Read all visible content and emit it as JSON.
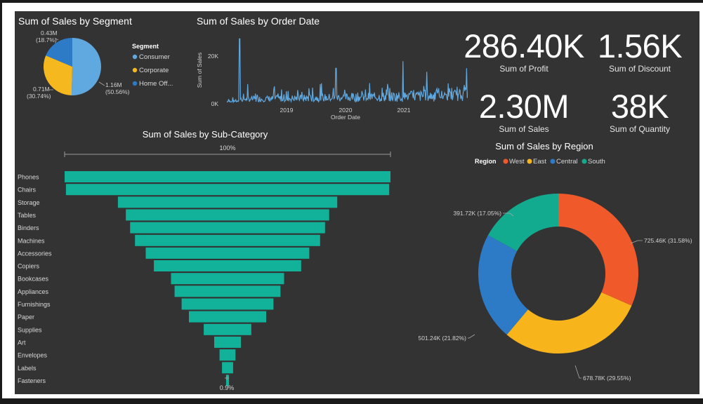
{
  "segment_chart": {
    "title": "Sum of Sales by Segment",
    "legend_title": "Segment",
    "legend": [
      {
        "label": "Consumer",
        "color": "#5fa8e0"
      },
      {
        "label": "Corporate",
        "color": "#f5b81e"
      },
      {
        "label": "Home Off...",
        "color": "#2d7bc7"
      }
    ],
    "slice_labels": [
      {
        "line1": "1.16M",
        "line2": "(50.56%)"
      },
      {
        "line1": "0.71M",
        "line2": "(30.74%)"
      },
      {
        "line1": "0.43M",
        "line2": "(18.7%)"
      }
    ]
  },
  "date_chart": {
    "title": "Sum of Sales by Order Date",
    "xlabel": "Order Date",
    "ylabel": "Sum of Sales",
    "yticks": [
      "20K",
      "0K"
    ],
    "xticks": [
      "2019",
      "2020",
      "2021"
    ],
    "color": "#5fa8e0"
  },
  "kpis": [
    {
      "value": "286.40K",
      "label": "Sum of Profit"
    },
    {
      "value": "1.56K",
      "label": "Sum of Discount"
    },
    {
      "value": "2.30M",
      "label": "Sum of Sales"
    },
    {
      "value": "38K",
      "label": "Sum of Quantity"
    }
  ],
  "subcat_chart": {
    "title": "Sum of Sales by Sub-Category",
    "top_label": "100%",
    "bottom_label": "0.9%",
    "color": "#12b29a"
  },
  "region_chart": {
    "title": "Sum of Sales by Region",
    "legend_title": "Region",
    "legend": [
      {
        "label": "West",
        "color": "#f05a2a"
      },
      {
        "label": "East",
        "color": "#f8b51b"
      },
      {
        "label": "Central",
        "color": "#2d7bc7"
      },
      {
        "label": "South",
        "color": "#13ab8f"
      }
    ],
    "slice_labels": [
      "725.46K (31.58%)",
      "678.78K (29.55%)",
      "501.24K (21.82%)",
      "391.72K (17.05%)"
    ]
  },
  "chart_data": [
    {
      "type": "pie",
      "title": "Sum of Sales by Segment",
      "legend": "Segment",
      "categories": [
        "Consumer",
        "Corporate",
        "Home Office"
      ],
      "values": [
        1.16,
        0.71,
        0.43
      ],
      "percentages": [
        50.56,
        30.74,
        18.7
      ],
      "unit": "M"
    },
    {
      "type": "line",
      "title": "Sum of Sales by Order Date",
      "xlabel": "Order Date",
      "ylabel": "Sum of Sales",
      "x_range": [
        "2018-01-01",
        "2021-12-31"
      ],
      "ylim": [
        0,
        28000
      ],
      "yticks": [
        0,
        20000
      ],
      "xticks": [
        "2019",
        "2020",
        "2021"
      ],
      "peaks": [
        {
          "x": "2018-03-18",
          "y": 27000
        },
        {
          "x": "2019-10-02",
          "y": 14500
        },
        {
          "x": "2020-10-28",
          "y": 17500
        },
        {
          "x": "2021-03-17",
          "y": 13000
        },
        {
          "x": "2021-11-05",
          "y": 14500
        }
      ],
      "typical_level": 4000
    },
    {
      "type": "bar",
      "title": "Sum of Sales by Sub-Category",
      "orientation": "horizontal-funnel",
      "categories": [
        "Phones",
        "Chairs",
        "Storage",
        "Tables",
        "Binders",
        "Machines",
        "Accessories",
        "Copiers",
        "Bookcases",
        "Appliances",
        "Furnishings",
        "Paper",
        "Supplies",
        "Art",
        "Envelopes",
        "Labels",
        "Fasteners"
      ],
      "percent_of_first": [
        100,
        99.2,
        67.3,
        62.4,
        59.8,
        56.8,
        50.2,
        45.2,
        34.7,
        32.5,
        28.2,
        23.7,
        14.6,
        8.2,
        4.9,
        3.4,
        0.9
      ],
      "top_label": "100%",
      "bottom_label": "0.9%"
    },
    {
      "type": "pie",
      "title": "Sum of Sales by Region",
      "style": "donut",
      "legend": "Region",
      "categories": [
        "West",
        "East",
        "Central",
        "South"
      ],
      "values": [
        725.46,
        678.78,
        501.24,
        391.72
      ],
      "percentages": [
        31.58,
        29.55,
        21.82,
        17.05
      ],
      "unit": "K"
    }
  ]
}
